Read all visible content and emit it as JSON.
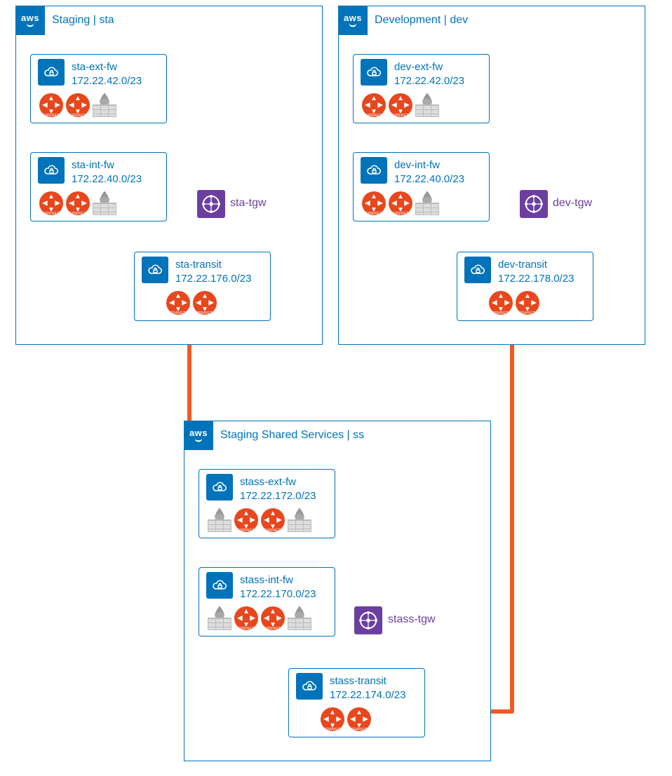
{
  "accounts": {
    "sta": {
      "title": "Staging | sta",
      "tgw_label": "sta-tgw",
      "vpcs": {
        "ext": {
          "name": "sta-ext-fw",
          "cidr": "172.22.42.0/23"
        },
        "int": {
          "name": "sta-int-fw",
          "cidr": "172.22.40.0/23"
        },
        "transit": {
          "name": "sta-transit",
          "cidr": "172.22.176.0/23"
        }
      }
    },
    "dev": {
      "title": "Development | dev",
      "tgw_label": "dev-tgw",
      "vpcs": {
        "ext": {
          "name": "dev-ext-fw",
          "cidr": "172.22.42.0/23"
        },
        "int": {
          "name": "dev-int-fw",
          "cidr": "172.22.40.0/23"
        },
        "transit": {
          "name": "dev-transit",
          "cidr": "172.22.178.0/23"
        }
      }
    },
    "ss": {
      "title": "Staging Shared Services | ss",
      "tgw_label": "stass-tgw",
      "vpcs": {
        "ext": {
          "name": "stass-ext-fw",
          "cidr": "172.22.172.0/23"
        },
        "int": {
          "name": "stass-int-fw",
          "cidr": "172.22.170.0/23"
        },
        "transit": {
          "name": "stass-transit",
          "cidr": "172.22.174.0/23"
        }
      }
    }
  },
  "colors": {
    "aws_blue": "#0073bb",
    "aviatrix_orange": "#e8471d",
    "tgw_purple": "#6b3fa0",
    "peering_orange": "#ed5b24",
    "connector_gray": "#7a7a7a"
  },
  "icon_labels": {
    "firenet": "FIRENET",
    "transit": "TRANSIT"
  }
}
